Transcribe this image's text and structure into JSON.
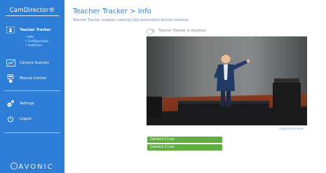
{
  "sidebar": {
    "brand": "CamDirector®",
    "items": [
      {
        "label": "Teacher Tracker",
        "icon": "teacher-tracker-icon"
      },
      {
        "label": "Camera Scanner",
        "icon": "camera-scanner-icon"
      },
      {
        "label": "Manual Control",
        "icon": "manual-control-icon"
      },
      {
        "label": "Settings",
        "icon": "gear-icon"
      },
      {
        "label": "Logout",
        "icon": "power-icon"
      }
    ],
    "subitems": [
      "Info",
      "Configuration",
      "Audience"
    ],
    "logo": "AVONIC"
  },
  "main": {
    "title": "Teacher Tracker > Info",
    "subtitle": "Teacher Tracker enables creating fully-automated lecture streams.",
    "toggle_label": "Teacher Tracker is disabled",
    "preview_caption": "Output preview",
    "cameras": [
      "Camera 1 Live",
      "Camera 2 Live"
    ]
  },
  "colors": {
    "sidebar": "#2e7dd6",
    "accent": "#2e7dd6",
    "live": "#5fae3f"
  }
}
